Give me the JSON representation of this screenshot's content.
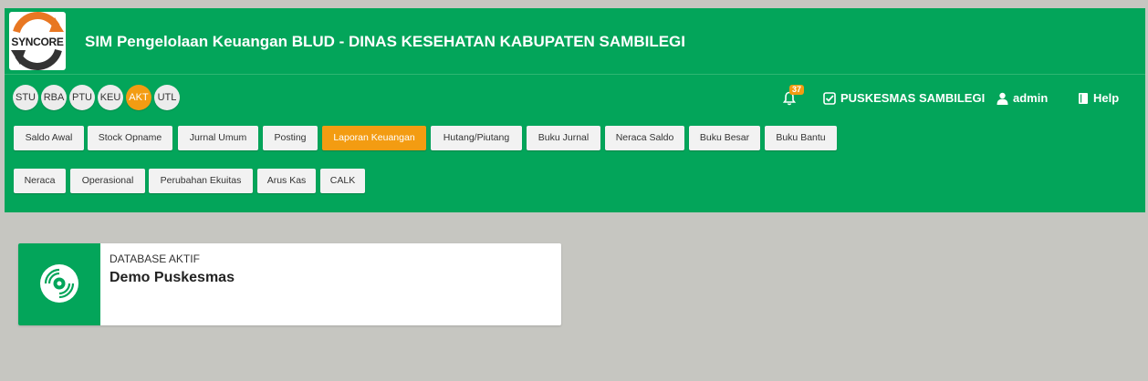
{
  "app": {
    "logo_text": "SYNCORE",
    "title": "SIM Pengelolaan Keuangan BLUD -  DINAS KESEHATAN KABUPATEN SAMBILEGI"
  },
  "modules": [
    {
      "label": "STU",
      "active": false
    },
    {
      "label": "RBA",
      "active": false
    },
    {
      "label": "PTU",
      "active": false
    },
    {
      "label": "KEU",
      "active": false
    },
    {
      "label": "AKT",
      "active": true
    },
    {
      "label": "UTL",
      "active": false
    }
  ],
  "nav": {
    "notification_count": "37",
    "organization": "PUSKESMAS SAMBILEGI",
    "user": "admin",
    "help": "Help"
  },
  "menu_row1": [
    {
      "label": "Saldo Awal",
      "active": false
    },
    {
      "label": "Stock Opname",
      "active": false
    },
    {
      "label": "Jurnal Umum",
      "active": false
    },
    {
      "label": "Posting",
      "active": false
    },
    {
      "label": "Laporan Keuangan",
      "active": true
    },
    {
      "label": "Hutang/Piutang",
      "active": false
    },
    {
      "label": "Buku Jurnal",
      "active": false
    },
    {
      "label": "Neraca Saldo",
      "active": false
    },
    {
      "label": "Buku Besar",
      "active": false
    },
    {
      "label": "Buku Bantu",
      "active": false
    }
  ],
  "menu_row2": [
    {
      "label": "Neraca",
      "active": false
    },
    {
      "label": "Operasional",
      "active": false
    },
    {
      "label": "Perubahan Ekuitas",
      "active": false
    },
    {
      "label": "Arus Kas",
      "active": false
    },
    {
      "label": "CALK",
      "active": false
    }
  ],
  "card": {
    "label": "DATABASE AKTIF",
    "value": "Demo Puskesmas",
    "icon": "disc-icon"
  },
  "colors": {
    "header_green": "#03a55a",
    "accent_orange": "#f39c12",
    "page_bg": "#c6c6c1"
  }
}
